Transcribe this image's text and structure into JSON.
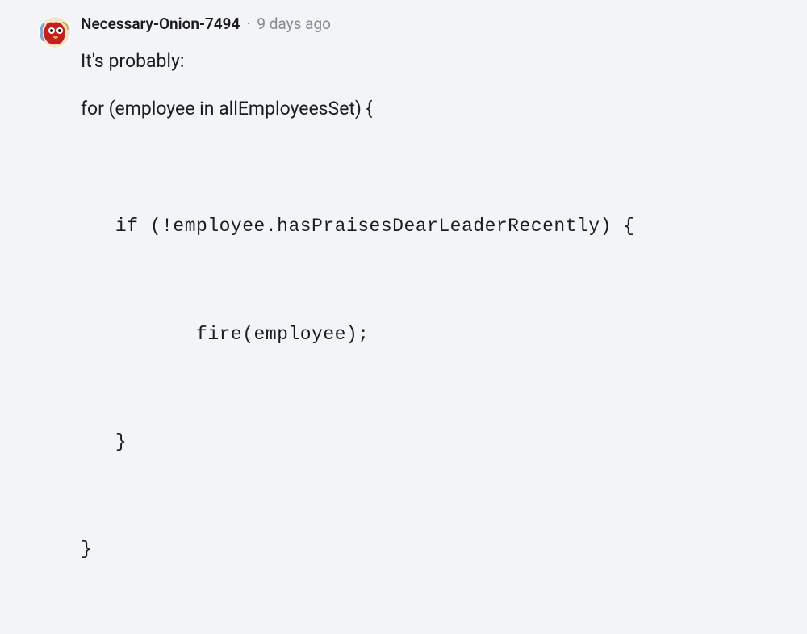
{
  "comment": {
    "username": "Necessary-Onion-7494",
    "timestamp": "9 days ago",
    "body_intro": "It's probably:",
    "body_line1": "for (employee in allEmployeesSet) {",
    "code_lines": [
      "   if (!employee.hasPraisesDearLeaderRecently) {",
      "",
      "          fire(employee);",
      "",
      "   }",
      "",
      "}"
    ]
  },
  "separator": "·"
}
